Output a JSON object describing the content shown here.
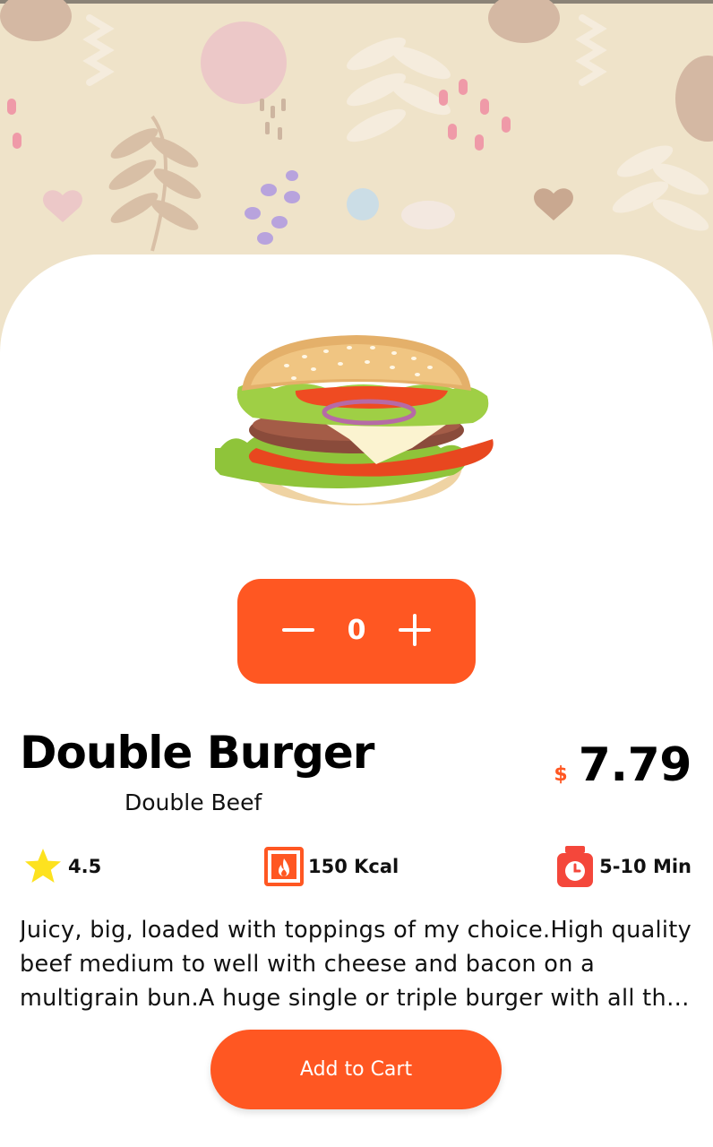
{
  "product": {
    "name": "Double Burger",
    "subtitle": "Double Beef",
    "currency": "$",
    "price": "7.79",
    "description": "Juicy, big, loaded with toppings of my choice.High quality beef medium to well with cheese and bacon on a multigrain bun.A huge single or triple burger with all the fixings, cheese, lettuce, tomato, onions and special sauce or mayonnaise!"
  },
  "stepper": {
    "quantity": "0",
    "minus_icon": "minus-icon",
    "plus_icon": "plus-icon"
  },
  "stats": {
    "rating": "4.5",
    "calories": "150 Kcal",
    "time": "5-10 Min",
    "rating_icon": "star-icon",
    "calories_icon": "fire-icon",
    "time_icon": "timer-icon"
  },
  "actions": {
    "add_to_cart": "Add to Cart"
  },
  "colors": {
    "accent": "#ff5722",
    "background_pattern": "#efe3c9",
    "star": "#fde21f",
    "text": "#000000"
  }
}
